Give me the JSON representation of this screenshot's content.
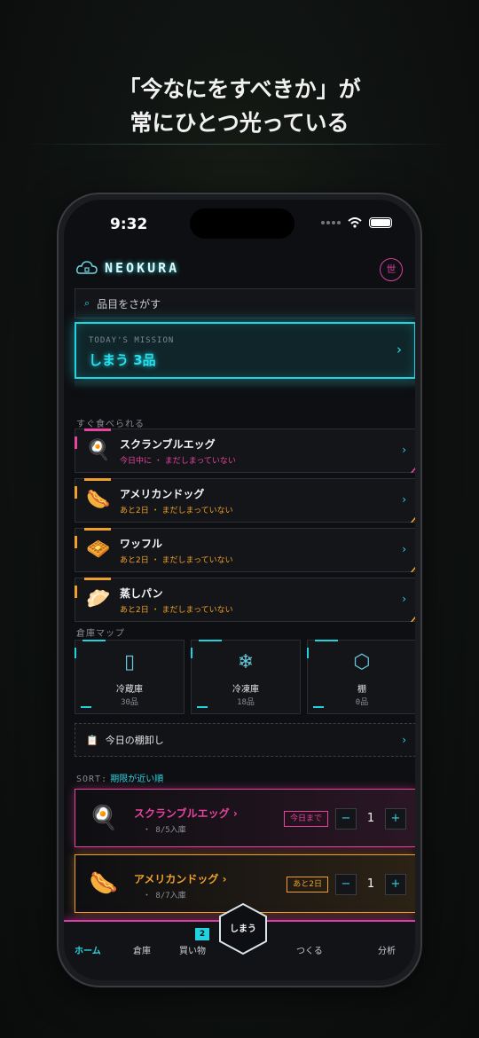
{
  "headline": {
    "line1": "「今なにをすべきか」が",
    "line2": "常にひとつ光っている"
  },
  "status": {
    "time": "9:32"
  },
  "app": {
    "logo": "NEOKURA",
    "globe_label": "世"
  },
  "search": {
    "placeholder": "品目をさがす"
  },
  "mission": {
    "kicker": "TODAY'S MISSION",
    "title": "しまう 3品",
    "chevron": "›"
  },
  "ready_section": {
    "label": "すぐ食べられる",
    "items": [
      {
        "icon": "🍳",
        "icon_name": "scrambled-egg-icon",
        "name": "スクランブルエッグ",
        "status": "今日中に ・ まだしまっていない",
        "color": "#e8439f"
      },
      {
        "icon": "🌭",
        "icon_name": "corn-dog-icon",
        "name": "アメリカンドッグ",
        "status": "あと2日 ・ まだしまっていない",
        "color": "#f0a02a"
      },
      {
        "icon": "🧇",
        "icon_name": "waffle-icon",
        "name": "ワッフル",
        "status": "あと2日 ・ まだしまっていない",
        "color": "#f0a02a"
      },
      {
        "icon": "🥟",
        "icon_name": "steamed-bun-icon",
        "name": "蒸しパン",
        "status": "あと2日 ・ まだしまっていない",
        "color": "#f0a02a"
      }
    ]
  },
  "storage_section": {
    "label": "倉庫マップ",
    "items": [
      {
        "icon": "▯",
        "icon_name": "fridge-icon",
        "name": "冷蔵庫",
        "count": "30品"
      },
      {
        "icon": "❄",
        "icon_name": "freezer-icon",
        "name": "冷凍庫",
        "count": "18品"
      },
      {
        "icon": "⬡",
        "icon_name": "shelf-box-icon",
        "name": "棚",
        "count": "0品"
      }
    ]
  },
  "stocktake": {
    "label": "今日の棚卸し",
    "icon": "📋"
  },
  "sort": {
    "key": "SORT:",
    "value": "期限が近い順"
  },
  "inventory": [
    {
      "icon": "🍳",
      "icon_name": "scrambled-egg-icon",
      "name": "スクランブルエッグ ›",
      "date": "・ 8/5入庫",
      "badge": "今日まで",
      "qty": "1",
      "color": "#e8439f"
    },
    {
      "icon": "🌭",
      "icon_name": "corn-dog-icon",
      "name": "アメリカンドッグ ›",
      "date": "・ 8/7入庫",
      "badge": "あと2日",
      "qty": "1",
      "color": "#f0a02a"
    }
  ],
  "stepper": {
    "minus": "−",
    "plus": "+"
  },
  "tabbar": {
    "home": "ホーム",
    "storage": "倉庫",
    "shopping": "買い物",
    "shopping_badge": "2",
    "store": "しまう",
    "cook": "つくる",
    "analysis": "分析"
  },
  "colors": {
    "accent": "#21d3df",
    "urgent": "#e8439f",
    "soon": "#f0a02a"
  }
}
